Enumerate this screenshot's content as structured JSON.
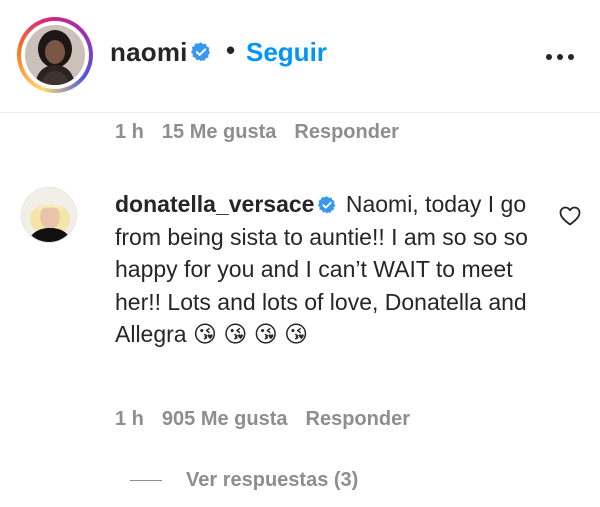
{
  "post_header": {
    "username": "naomi",
    "separator": "•",
    "follow_label": "Seguir",
    "follow_color": "#0095f6"
  },
  "previous_comment": {
    "time": "1 h",
    "likes": "15 Me gusta",
    "reply_label": "Responder"
  },
  "comment": {
    "username": "donatella_versace",
    "text": "Naomi, today I go from being sista to auntie!! I am so so so happy for you and I can’t WAIT to meet her!! Lots and lots of love, Donatella and Allegra 😘 😘 😘 😘",
    "time": "1 h",
    "likes": "905 Me gusta",
    "reply_label": "Responder",
    "view_replies": "Ver respuestas (3)"
  },
  "icons": {
    "verified": "verified-badge-icon",
    "more": "more-options-icon",
    "like": "heart-outline-icon"
  },
  "colors": {
    "text": "#262626",
    "muted": "#8e8e8e",
    "verified": "#3897f0"
  }
}
